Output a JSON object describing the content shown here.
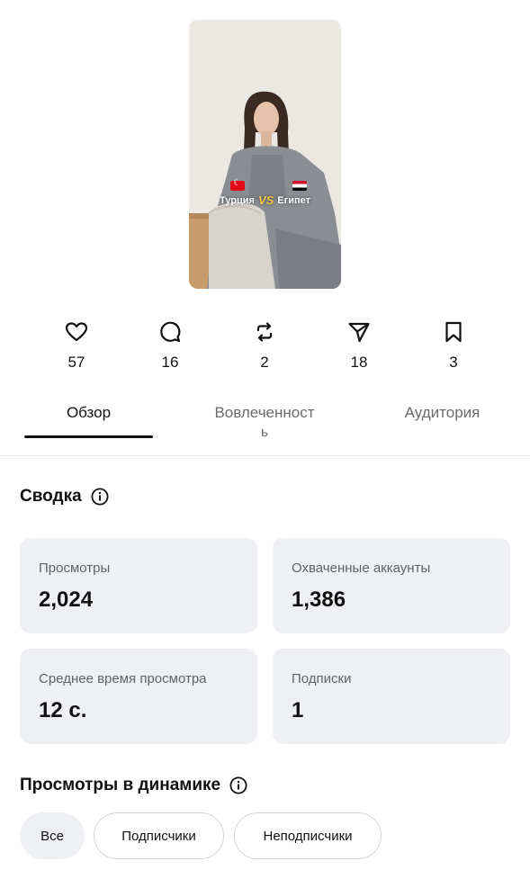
{
  "reel": {
    "caption_left": "Турция",
    "caption_vs": "VS",
    "caption_right": "Египет"
  },
  "stats": [
    {
      "icon": "heart-icon",
      "value": "57"
    },
    {
      "icon": "comment-icon",
      "value": "16"
    },
    {
      "icon": "repost-icon",
      "value": "2"
    },
    {
      "icon": "share-icon",
      "value": "18"
    },
    {
      "icon": "bookmark-icon",
      "value": "3"
    }
  ],
  "tabs": {
    "overview": "Обзор",
    "engagement_line1": "Вовлеченност",
    "engagement_line2": "ь",
    "audience": "Аудитория"
  },
  "summary": {
    "title": "Сводка",
    "cards": [
      {
        "label": "Просмотры",
        "value": "2,024"
      },
      {
        "label": "Охваченные аккаунты",
        "value": "1,386"
      },
      {
        "label": "Среднее время просмотра",
        "value": "12 с."
      },
      {
        "label": "Подписки",
        "value": "1"
      }
    ]
  },
  "dynamics": {
    "title": "Просмотры в динамике",
    "filters": [
      "Все",
      "Подписчики",
      "Неподписчики"
    ]
  }
}
